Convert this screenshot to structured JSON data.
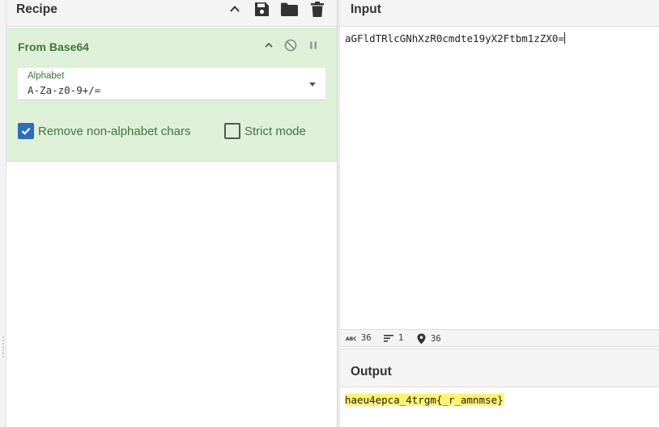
{
  "recipe": {
    "title": "Recipe",
    "icons": [
      "chevron-up-icon",
      "save-icon",
      "folder-icon",
      "trash-icon"
    ]
  },
  "operation": {
    "title": "From Base64",
    "alphabet": {
      "label": "Alphabet",
      "value": "A-Za-z0-9+/="
    },
    "remove_non_alphabet": {
      "label": "Remove non-alphabet chars",
      "checked": true
    },
    "strict_mode": {
      "label": "Strict mode",
      "checked": false
    }
  },
  "input": {
    "title": "Input",
    "text": "aGFldTRlcGNhXzR0cmdte19yX2Ftbm1zZX0="
  },
  "status": {
    "length": "36",
    "lines": "1",
    "position": "36"
  },
  "output": {
    "title": "Output",
    "text": "haeu4epca_4trgm{_r_amnmse}"
  },
  "colors": {
    "operation_bg": "#dff0d8",
    "operation_text": "#3c763d",
    "checkbox_accent": "#2a6fbd",
    "output_highlight": "#fff36b"
  }
}
